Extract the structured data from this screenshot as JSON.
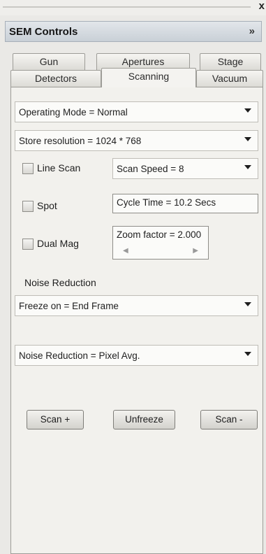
{
  "window": {
    "close_glyph": "x"
  },
  "panel": {
    "title": "SEM Controls",
    "collapse_glyph": "»"
  },
  "tabs": {
    "row_back": [
      "Gun",
      "Apertures",
      "Stage"
    ],
    "row_front": [
      "Detectors",
      "Scanning",
      "Vacuum"
    ],
    "active": "Scanning"
  },
  "scanning": {
    "operating_mode": "Operating Mode = Normal",
    "store_resolution": "Store resolution = 1024 * 768",
    "line_scan": {
      "label": "Line Scan",
      "checked": false
    },
    "scan_speed": "Scan Speed = 8",
    "spot": {
      "label": "Spot",
      "checked": false
    },
    "cycle_time": "Cycle Time = 10.2 Secs",
    "dual_mag": {
      "label": "Dual Mag",
      "checked": false
    },
    "zoom_factor": "Zoom factor =  2.000",
    "noise_reduction_heading": "Noise Reduction",
    "freeze_on": "Freeze on = End Frame",
    "noise_reduction": "Noise Reduction = Pixel Avg.",
    "buttons": {
      "scan_plus": "Scan +",
      "unfreeze": "Unfreeze",
      "scan_minus": "Scan -"
    }
  }
}
